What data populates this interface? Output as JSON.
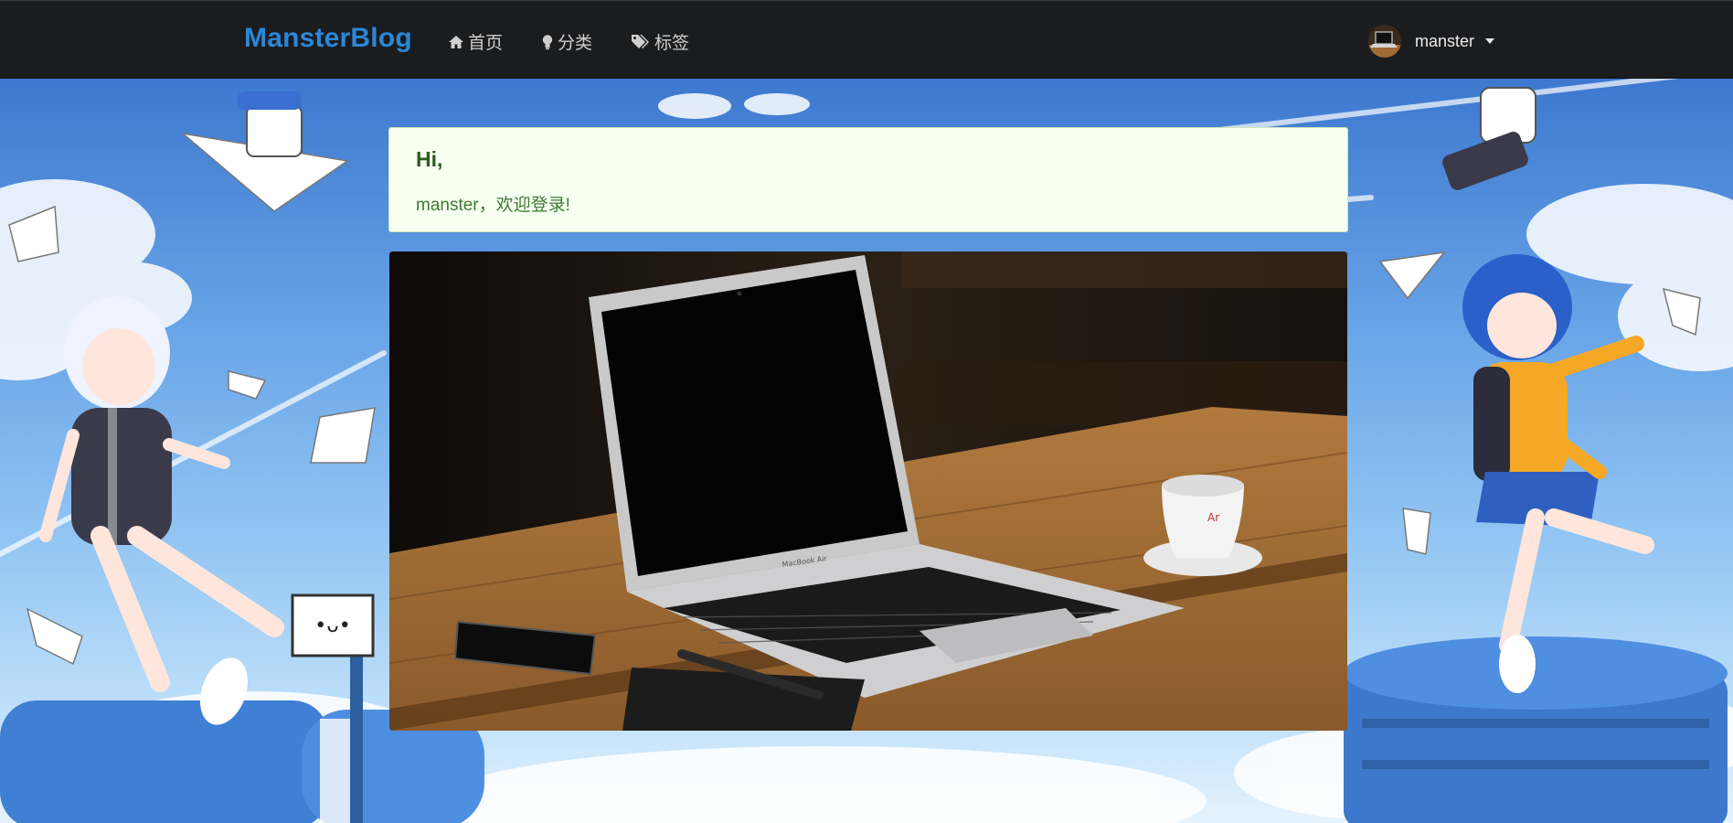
{
  "navbar": {
    "brand": "MansterBlog",
    "links": [
      {
        "label": "首页",
        "icon": "home-icon"
      },
      {
        "label": "分类",
        "icon": "lightbulb-icon"
      },
      {
        "label": "标签",
        "icon": "tags-icon"
      }
    ],
    "user": {
      "name": "manster",
      "avatar": "laptop-avatar-icon"
    }
  },
  "alert": {
    "title": "Hi,",
    "message": "manster，欢迎登录!"
  },
  "hero": {
    "laptop_brand": "MacBook Air",
    "cup_brand": "Ar"
  },
  "colors": {
    "navbar_bg": "#1b1c1e",
    "brand": "#2a87d8",
    "alert_bg": "#f7fff0",
    "alert_border": "#cde6b4",
    "alert_text": "#3f7a34"
  }
}
